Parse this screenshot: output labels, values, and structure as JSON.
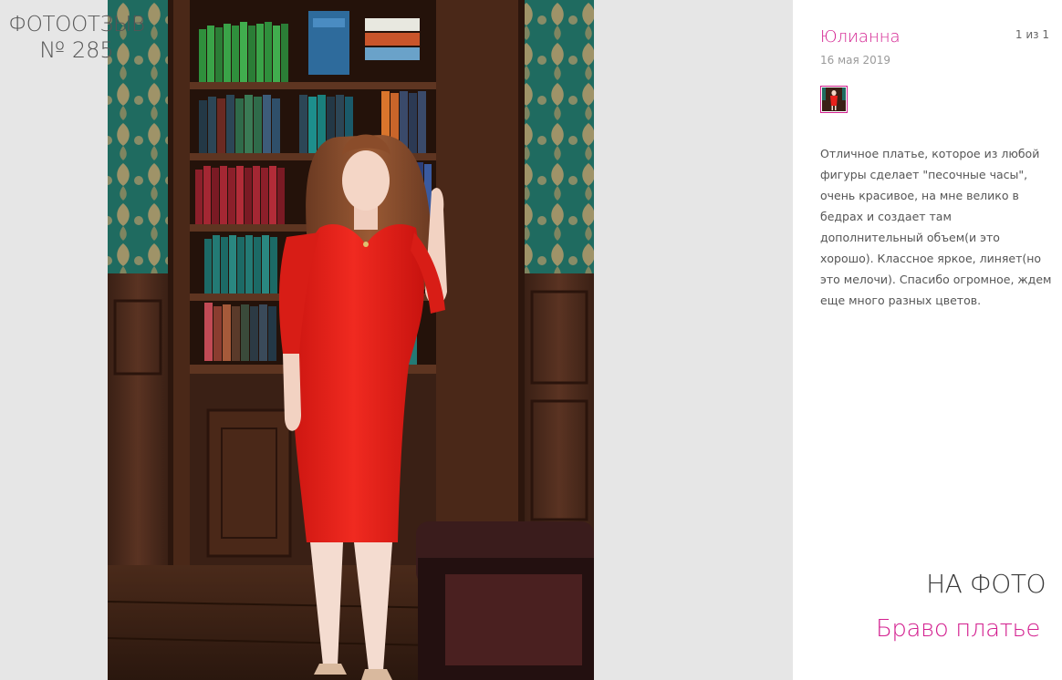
{
  "gallery": {
    "label": "ФОТООТЗЫВ",
    "number": "№ 285"
  },
  "photo": {
    "alt_icon": "photo-image"
  },
  "review": {
    "author": "Юлианна",
    "counter": "1 из 1",
    "date": "16 мая 2019",
    "text": "Отличное платье, которое из любой фигуры сделает \"песочные часы\", очень красивое, на мне велико в бедрах и создает там дополнительный объем(и это хорошо). Классное яркое, линяет(но это мелочи). Спасибо огромное, ждем еще много разных цветов."
  },
  "on_photo": {
    "label": "НА ФОТО",
    "product": "Браво платье"
  },
  "colors": {
    "accent": "#d31f8f",
    "gallery_bg": "#e6e6e6",
    "dress": "#e8211b"
  }
}
